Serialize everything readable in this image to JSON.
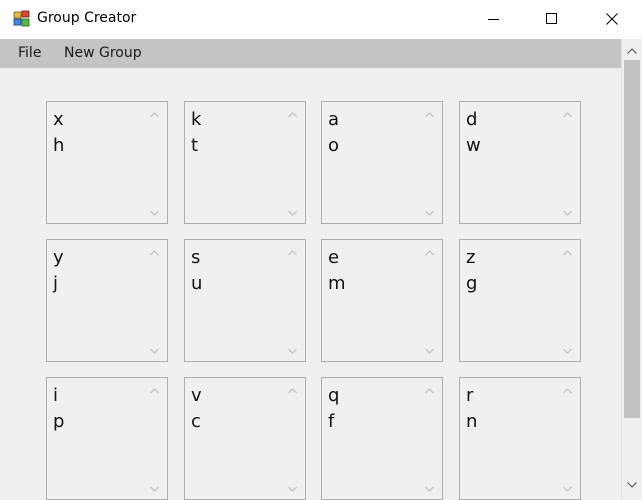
{
  "window": {
    "title": "Group Creator"
  },
  "menu": {
    "file_label": "File",
    "new_group_label": "New Group"
  },
  "groups": [
    {
      "lines": [
        "x",
        "h"
      ]
    },
    {
      "lines": [
        "k",
        "t"
      ]
    },
    {
      "lines": [
        "a",
        "o"
      ]
    },
    {
      "lines": [
        "d",
        "w"
      ]
    },
    {
      "lines": [
        "y",
        "j"
      ]
    },
    {
      "lines": [
        "s",
        "u"
      ]
    },
    {
      "lines": [
        "e",
        "m"
      ]
    },
    {
      "lines": [
        "z",
        "g"
      ]
    },
    {
      "lines": [
        "i",
        "p"
      ]
    },
    {
      "lines": [
        "v",
        "c"
      ]
    },
    {
      "lines": [
        "q",
        "f"
      ]
    },
    {
      "lines": [
        "r",
        "n"
      ]
    }
  ],
  "icons": {
    "app": "app-icon",
    "minimize": "minimize-icon",
    "maximize": "maximize-icon",
    "close": "close-icon",
    "scroll_up": "chevron-up-icon",
    "scroll_down": "chevron-down-icon"
  }
}
